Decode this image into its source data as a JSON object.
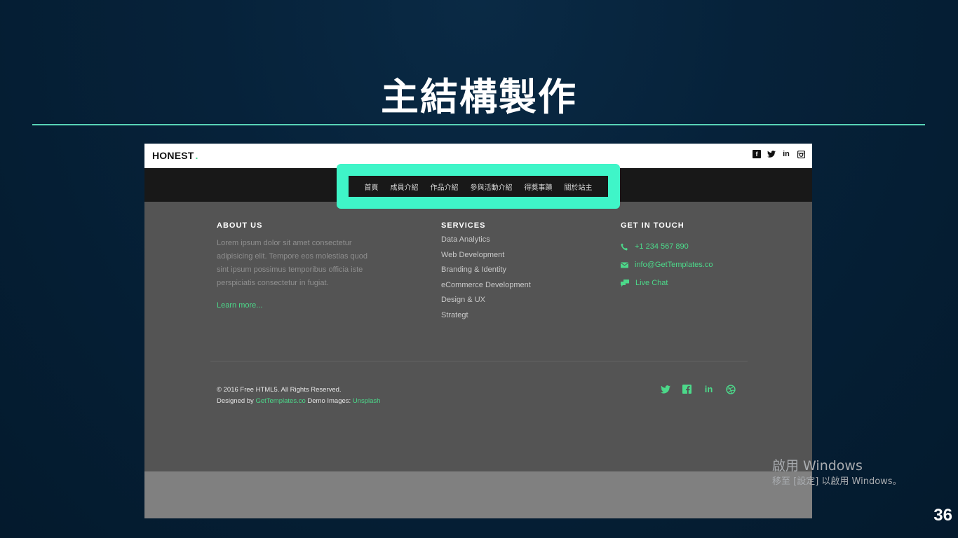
{
  "slide": {
    "title": "主結構製作",
    "page_number": "36"
  },
  "site": {
    "logo_text": "HONEST",
    "logo_dot": ".",
    "social_top": [
      "facebook-icon",
      "twitter-icon",
      "linkedin-icon",
      "instagram-icon"
    ],
    "nav": [
      {
        "label": "首頁"
      },
      {
        "label": "成員介紹"
      },
      {
        "label": "作品介紹"
      },
      {
        "label": "參與活動介紹"
      },
      {
        "label": "得獎事蹟"
      },
      {
        "label": "關於站主"
      }
    ],
    "about": {
      "title": "ABOUT US",
      "text": "Lorem ipsum dolor sit amet consectetur adipisicing elit. Tempore eos molestias quod sint ipsum possimus temporibus officia iste perspiciatis consectetur in fugiat.",
      "link": "Learn more..."
    },
    "services": {
      "title": "SERVICES",
      "items": [
        "Data Analytics",
        "Web Development",
        "Branding & Identity",
        "eCommerce Development",
        "Design & UX",
        "Strategt"
      ]
    },
    "contact": {
      "title": "GET IN TOUCH",
      "phone": "+1 234 567 890",
      "email": "info@GetTemplates.co",
      "chat": "Live Chat"
    },
    "footer": {
      "copyright": "© 2016 Free HTML5. All Rights Reserved.",
      "designed_prefix": "Designed by",
      "designed_link": "GetTemplates.co",
      "demo_prefix": "Demo Images:",
      "demo_link": "Unsplash",
      "social_bottom": [
        "twitter-icon",
        "facebook-icon",
        "linkedin-icon",
        "dribbble-icon"
      ]
    }
  },
  "watermark": {
    "line1": "啟用 Windows",
    "line2": "移至 [設定] 以啟用 Windows。"
  },
  "colors": {
    "accent": "#4cd98a",
    "highlight": "#3ff5c8",
    "title_rule": "#58d3b6"
  }
}
